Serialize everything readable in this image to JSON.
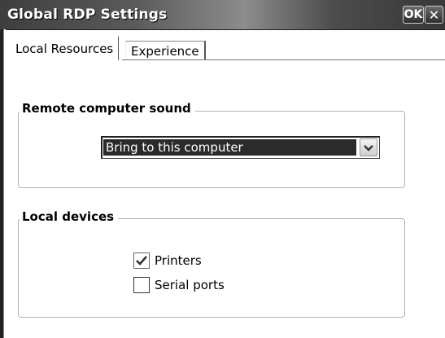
{
  "window": {
    "title": "Global RDP Settings",
    "ok_label": "OK",
    "close_label": "✕"
  },
  "tabs": [
    {
      "label": "Local Resources",
      "selected": true
    },
    {
      "label": "Experience",
      "selected": false
    }
  ],
  "sound_group": {
    "label": "Remote computer sound",
    "selected_value": "Bring to this computer",
    "dropdown_icon": "chevron-down-icon"
  },
  "devices_group": {
    "label": "Local devices",
    "items": [
      {
        "label": "Printers",
        "checked": true
      },
      {
        "label": "Serial ports",
        "checked": false
      }
    ]
  }
}
